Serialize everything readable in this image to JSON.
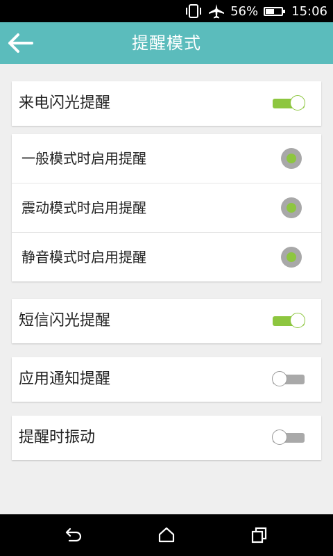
{
  "status_bar": {
    "battery_percent": "56%",
    "battery_level": 0.56,
    "time": "15:06",
    "icons": [
      "vibrate-icon",
      "airplane-mode-icon",
      "battery-charging-icon"
    ]
  },
  "app_bar": {
    "title": "提醒模式",
    "back_icon": "arrow-left-icon"
  },
  "settings": {
    "call_flash": {
      "label": "来电闪光提醒",
      "enabled": true
    },
    "modes": [
      {
        "label": "一般模式时启用提醒",
        "selected": true
      },
      {
        "label": "震动模式时启用提醒",
        "selected": true
      },
      {
        "label": "静音模式时启用提醒",
        "selected": true
      }
    ],
    "sms_flash": {
      "label": "短信闪光提醒",
      "enabled": true
    },
    "app_notification": {
      "label": "应用通知提醒",
      "enabled": false
    },
    "vibrate_on_alert": {
      "label": "提醒时振动",
      "enabled": false
    }
  },
  "colors": {
    "app_bar": "#5bbcbc",
    "toggle_on": "#8dc63f",
    "toggle_off": "#a9a9a9",
    "radio_ring": "#a8a8a8",
    "radio_dot": "#8dc63f",
    "background": "#efefef"
  },
  "nav_bar": {
    "icons": [
      "back-icon",
      "home-icon",
      "recent-apps-icon"
    ]
  }
}
